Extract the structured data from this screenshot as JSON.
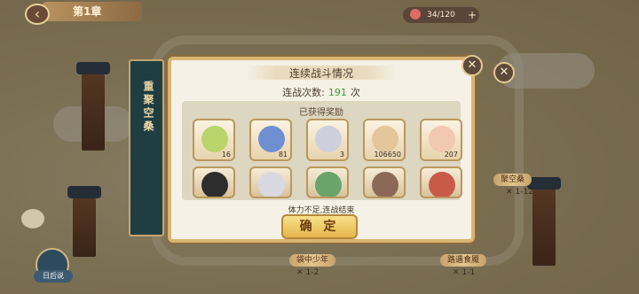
{
  "header": {
    "chapter_title": "第1章",
    "stamina_text": "34/120"
  },
  "side_panel": {
    "title": "重聚空桑"
  },
  "map_nodes": {
    "n1_sub": "1-2",
    "n1_label": "袋中少年",
    "n2_label": "路遇食魇",
    "n2_sub": "1-1",
    "n3_label": "聚空桑",
    "n3_sub": "1-12"
  },
  "bottom_left": {
    "later_label": "日后说"
  },
  "dialog": {
    "title": "连续战斗情况",
    "count_label": "连战次数:",
    "count_value": "191",
    "count_unit": "次",
    "rewards_title": "已获得奖励",
    "status": "体力不足,连战结束",
    "confirm_label": "确 定"
  },
  "rewards": [
    {
      "icon": "jade-disc-icon",
      "qty": "16",
      "color": "#b8d46a"
    },
    {
      "icon": "crystal-shard-icon",
      "qty": "81",
      "color": "#6f8fd0"
    },
    {
      "icon": "dumpling-icon",
      "qty": "3",
      "color": "#cdd0dc"
    },
    {
      "icon": "gold-ingot-icon",
      "qty": "106650",
      "color": "#e3c69a"
    },
    {
      "icon": "bun-icon",
      "qty": "207",
      "color": "#f1c8b0"
    }
  ],
  "characters": [
    {
      "icon": "character-black-hair-icon",
      "color": "#2d2d2d"
    },
    {
      "icon": "character-white-hair-icon",
      "color": "#d8d8e0"
    },
    {
      "icon": "character-green-hair-icon",
      "color": "#6aa46a"
    },
    {
      "icon": "character-brown-hair-icon",
      "color": "#8a6a56"
    },
    {
      "icon": "character-red-hair-icon",
      "color": "#c95a4a"
    }
  ]
}
